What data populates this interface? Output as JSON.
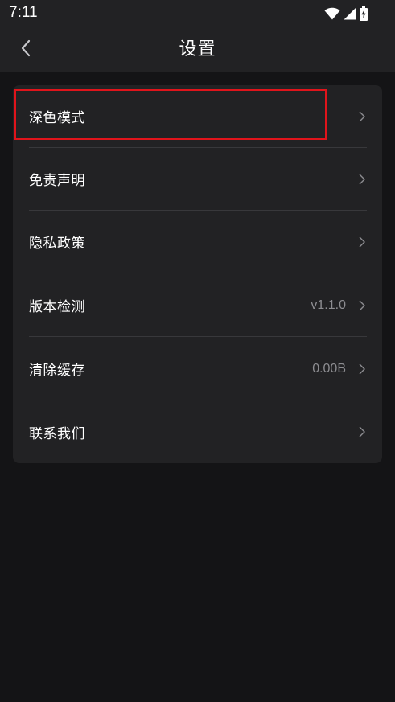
{
  "status_bar": {
    "time": "7:11",
    "icons": [
      "wifi-icon",
      "cellular-signal-icon",
      "battery-charging-icon"
    ]
  },
  "app_bar": {
    "title": "设置",
    "back_icon": "chevron-left-icon"
  },
  "settings": {
    "items": [
      {
        "label": "深色模式",
        "value": ""
      },
      {
        "label": "免责声明",
        "value": ""
      },
      {
        "label": "隐私政策",
        "value": ""
      },
      {
        "label": "版本检测",
        "value": "v1.1.0"
      },
      {
        "label": "清除缓存",
        "value": "0.00B"
      },
      {
        "label": "联系我们",
        "value": ""
      }
    ]
  },
  "colors": {
    "background": "#141416",
    "surface": "#222224",
    "divider": "#38383b",
    "secondary_text": "#8d8d91",
    "highlight": "#e0141b"
  }
}
